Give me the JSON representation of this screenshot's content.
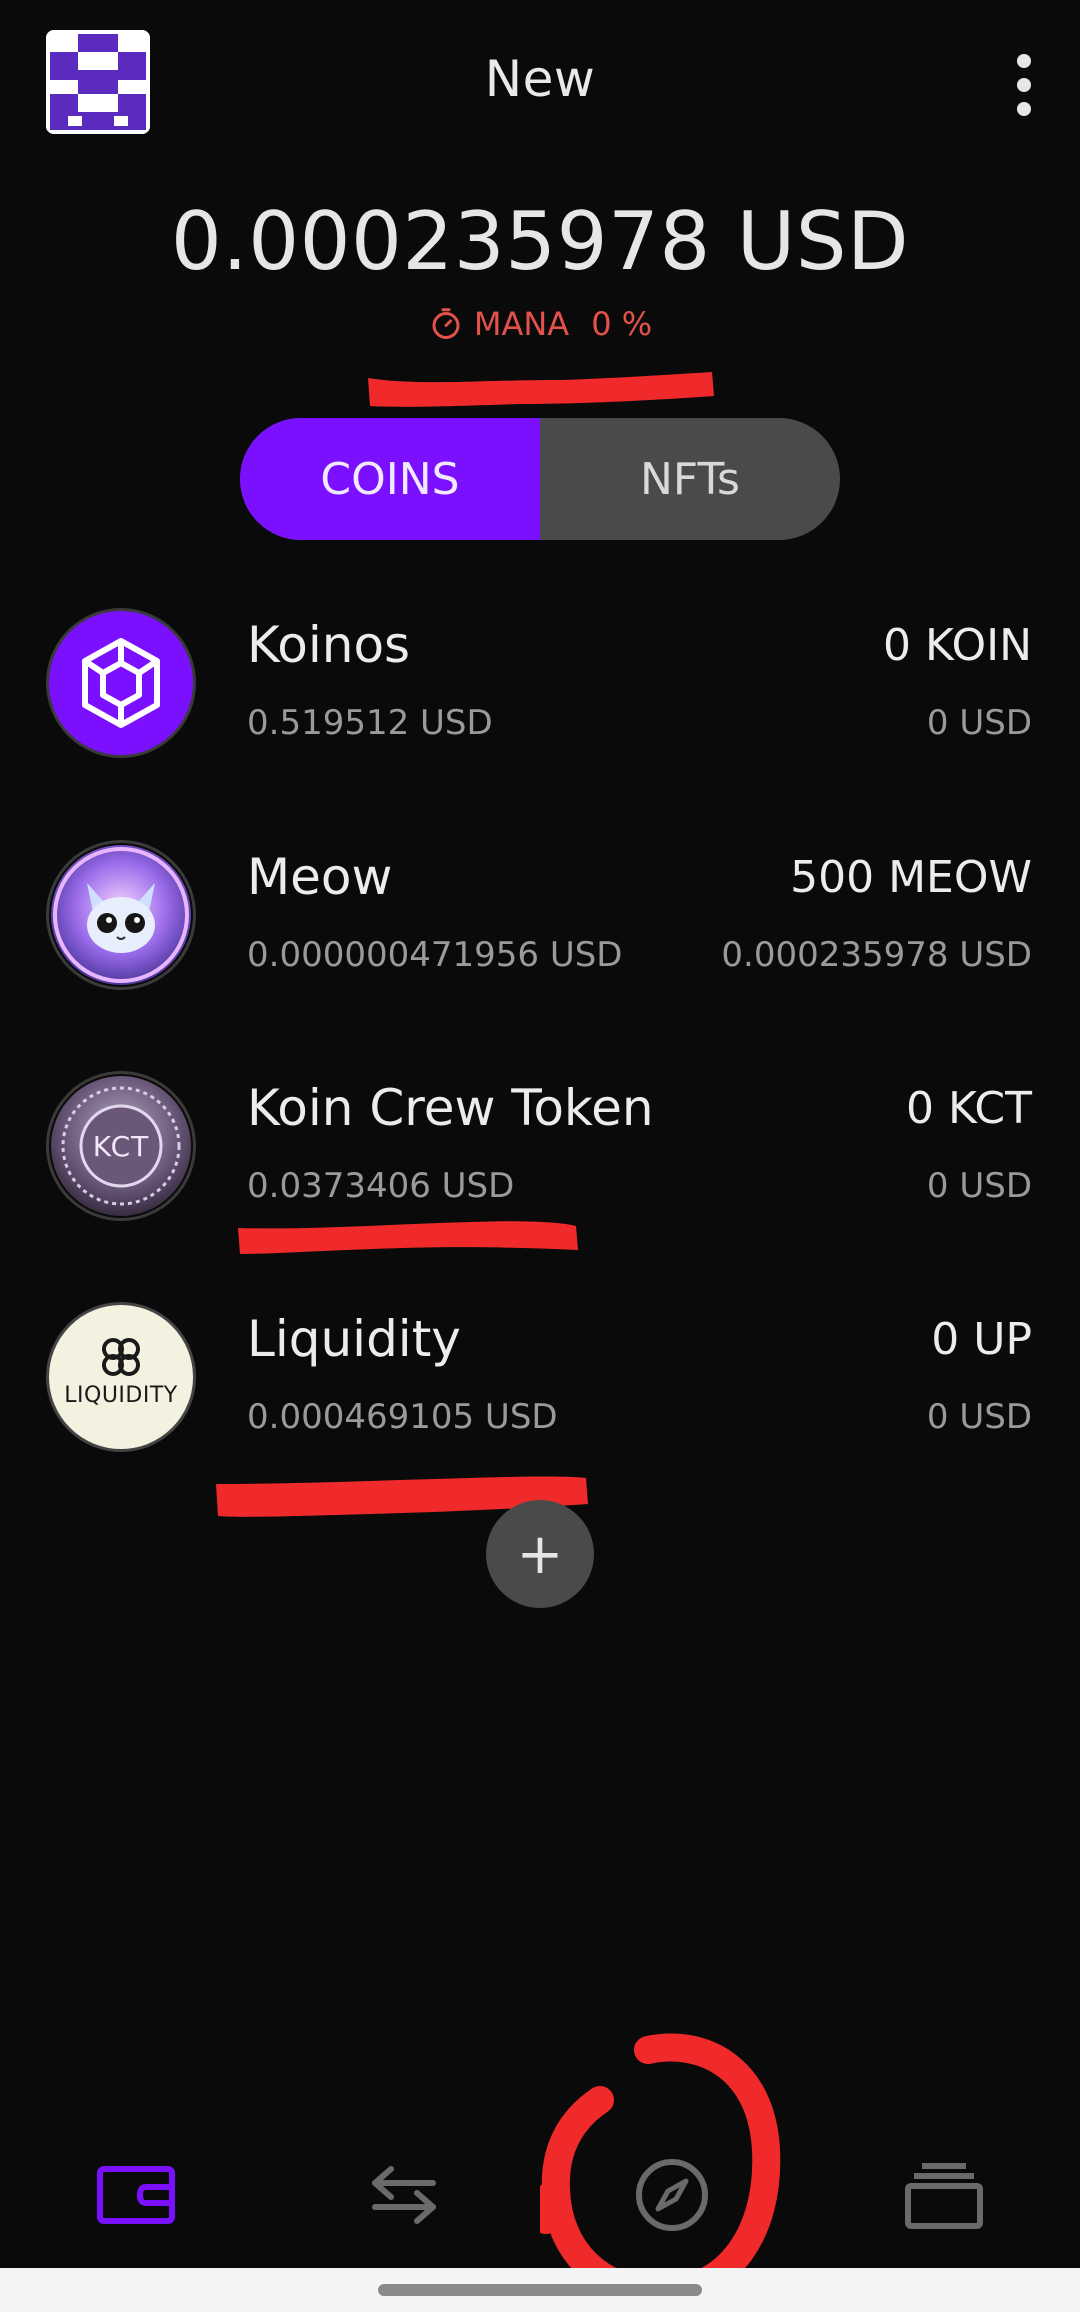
{
  "header": {
    "wallet_name": "New"
  },
  "balance": {
    "total": "0.000235978 USD"
  },
  "mana": {
    "label": "MANA",
    "percent": "0 %"
  },
  "tabs": [
    {
      "label": "COINS",
      "active": true
    },
    {
      "label": "NFTs",
      "active": false
    }
  ],
  "tokens": [
    {
      "name": "Koinos",
      "price": "0.519512 USD",
      "amount": "0 KOIN",
      "value": "0 USD"
    },
    {
      "name": "Meow",
      "price": "0.000000471956 USD",
      "amount": "500 MEOW",
      "value": "0.000235978 USD"
    },
    {
      "name": "Koin Crew Token",
      "price": "0.0373406 USD",
      "amount": "0 KCT",
      "value": "0 USD",
      "logo_text": "KCT"
    },
    {
      "name": "Liquidity",
      "price": "0.000469105 USD",
      "amount": "0 UP",
      "value": "0 USD",
      "logo_text": "LIQUIDITY"
    }
  ],
  "add_button": {
    "label": "+"
  },
  "nav": {
    "items": [
      "wallet-icon",
      "swap-icon",
      "compass-icon",
      "cards-icon"
    ],
    "active": "wallet-icon"
  },
  "colors": {
    "accent": "#7b10ff",
    "mana_red": "#e2524b",
    "annotation_red": "#f02a2a"
  }
}
